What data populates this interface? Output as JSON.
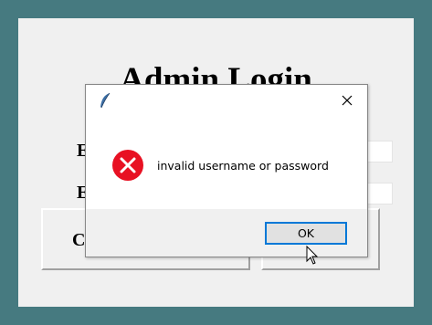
{
  "app": {
    "title": "Admin Login",
    "username_label_partial": "E",
    "password_label_partial": "E",
    "login_button_partial": "C"
  },
  "dialog": {
    "title": "",
    "app_icon": "feather-icon",
    "close_icon": "close-icon",
    "status_icon": "error-icon",
    "message": "invalid username or password",
    "ok_label": "OK",
    "colors": {
      "error_red": "#e81123",
      "focus_blue": "#0078d7",
      "desktop": "#467a80"
    }
  }
}
